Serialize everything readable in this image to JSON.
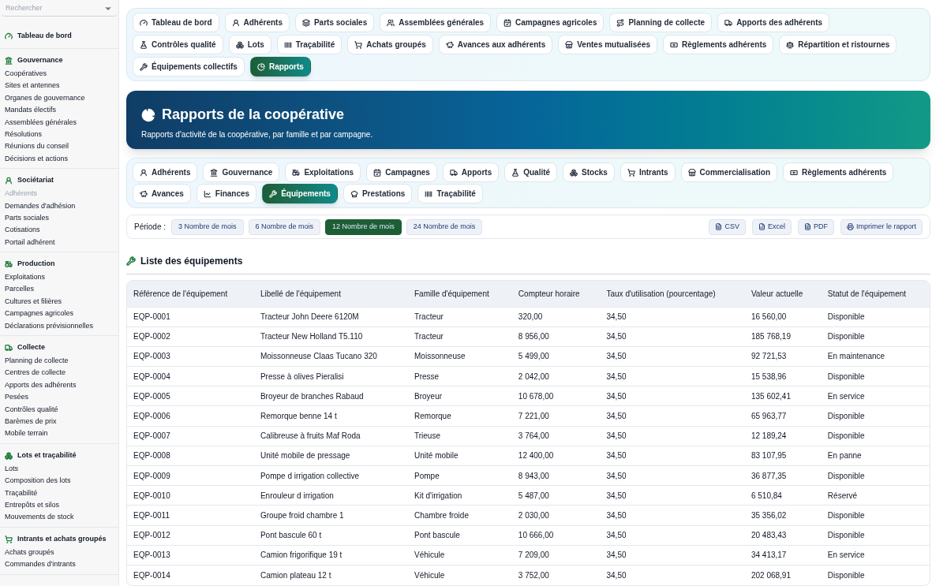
{
  "sidebar": {
    "search": {
      "placeholder": "Rechercher"
    },
    "sections": [
      {
        "title": "Tableau de bord"
      },
      {
        "title": "Gouvernance",
        "items": [
          {
            "label": "Coopératives",
            "disabled": false
          },
          {
            "label": "Sites et antennes",
            "disabled": false
          },
          {
            "label": "Organes de gouvernance",
            "disabled": false
          },
          {
            "label": "Mandats électifs",
            "disabled": false
          },
          {
            "label": "Assemblées générales",
            "disabled": false
          },
          {
            "label": "Résolutions",
            "disabled": false
          },
          {
            "label": "Réunions du conseil",
            "disabled": false
          },
          {
            "label": "Décisions et actions",
            "disabled": false
          }
        ]
      },
      {
        "title": "Sociétariat",
        "items": [
          {
            "label": "Adhérents",
            "disabled": true
          },
          {
            "label": "Demandes d'adhésion",
            "disabled": false
          },
          {
            "label": "Parts sociales",
            "disabled": false
          },
          {
            "label": "Cotisations",
            "disabled": false
          },
          {
            "label": "Portail adhérent",
            "disabled": false
          }
        ]
      },
      {
        "title": "Production",
        "items": [
          {
            "label": "Exploitations",
            "disabled": false
          },
          {
            "label": "Parcelles",
            "disabled": false
          },
          {
            "label": "Cultures et filières",
            "disabled": false
          },
          {
            "label": "Campagnes agricoles",
            "disabled": false
          },
          {
            "label": "Déclarations prévisionnelles",
            "disabled": false
          }
        ]
      },
      {
        "title": "Collecte",
        "items": [
          {
            "label": "Planning de collecte",
            "disabled": false
          },
          {
            "label": "Centres de collecte",
            "disabled": false
          },
          {
            "label": "Apports des adhérents",
            "disabled": false
          },
          {
            "label": "Pesées",
            "disabled": false
          },
          {
            "label": "Contrôles qualité",
            "disabled": false
          },
          {
            "label": "Barèmes de prix",
            "disabled": false
          },
          {
            "label": "Mobile terrain",
            "disabled": false
          }
        ]
      },
      {
        "title": "Lots et traçabilité",
        "items": [
          {
            "label": "Lots",
            "disabled": false
          },
          {
            "label": "Composition des lots",
            "disabled": false
          },
          {
            "label": "Traçabilité",
            "disabled": false
          },
          {
            "label": "Entrepôts et silos",
            "disabled": false
          },
          {
            "label": "Mouvements de stock",
            "disabled": false
          }
        ]
      },
      {
        "title": "Intrants et achats groupés",
        "items": [
          {
            "label": "Achats groupés",
            "disabled": false
          },
          {
            "label": "Commandes d'intrants",
            "disabled": false
          }
        ]
      }
    ]
  },
  "top_nav": [
    {
      "label": "Tableau de bord",
      "selected": false
    },
    {
      "label": "Adhérents",
      "selected": false
    },
    {
      "label": "Parts sociales",
      "selected": false
    },
    {
      "label": "Assemblées générales",
      "selected": false
    },
    {
      "label": "Campagnes agricoles",
      "selected": false
    },
    {
      "label": "Planning de collecte",
      "selected": false
    },
    {
      "label": "Apports des adhérents",
      "selected": false
    },
    {
      "label": "Contrôles qualité",
      "selected": false
    },
    {
      "label": "Lots",
      "selected": false
    },
    {
      "label": "Traçabilité",
      "selected": false
    },
    {
      "label": "Achats groupés",
      "selected": false
    },
    {
      "label": "Avances aux adhérents",
      "selected": false
    },
    {
      "label": "Ventes mutualisées",
      "selected": false
    },
    {
      "label": "Règlements adhérents",
      "selected": false
    },
    {
      "label": "Répartition et ristournes",
      "selected": false
    },
    {
      "label": "Équipements collectifs",
      "selected": false
    },
    {
      "label": "Rapports",
      "selected": true
    }
  ],
  "header": {
    "title": "Rapports de la coopérative",
    "subtitle": "Rapports d'activité de la coopérative, par famille et par campagne."
  },
  "report_tabs": [
    {
      "label": "Adhérents",
      "selected": false
    },
    {
      "label": "Gouvernance",
      "selected": false
    },
    {
      "label": "Exploitations",
      "selected": false
    },
    {
      "label": "Campagnes",
      "selected": false
    },
    {
      "label": "Apports",
      "selected": false
    },
    {
      "label": "Qualité",
      "selected": false
    },
    {
      "label": "Stocks",
      "selected": false
    },
    {
      "label": "Intrants",
      "selected": false
    },
    {
      "label": "Commercialisation",
      "selected": false
    },
    {
      "label": "Règlements adhérents",
      "selected": false
    },
    {
      "label": "Avances",
      "selected": false
    },
    {
      "label": "Finances",
      "selected": false
    },
    {
      "label": "Équipements",
      "selected": true
    },
    {
      "label": "Prestations",
      "selected": false
    },
    {
      "label": "Traçabilité",
      "selected": false
    }
  ],
  "period": {
    "label": "Période :",
    "options": [
      {
        "label": "3 Nombre de mois",
        "selected": false
      },
      {
        "label": "6 Nombre de mois",
        "selected": false
      },
      {
        "label": "12 Nombre de mois",
        "selected": true
      },
      {
        "label": "24 Nombre de mois",
        "selected": false
      }
    ]
  },
  "exports": [
    "CSV",
    "Excel",
    "PDF",
    "Imprimer le rapport"
  ],
  "section_title": "Liste des équipements",
  "table": {
    "columns": [
      "Référence de l'équipement",
      "Libellé de l'équipement",
      "Famille d'équipement",
      "Compteur horaire",
      "Taux d'utilisation (pourcentage)",
      "Valeur actuelle",
      "Statut de l'équipement"
    ],
    "rows": [
      [
        "EQP-0001",
        "Tracteur John Deere 6120M",
        "Tracteur",
        "320,00",
        "34,50",
        "16 560,00",
        "Disponible"
      ],
      [
        "EQP-0002",
        "Tracteur New Holland T5.110",
        "Tracteur",
        "8 956,00",
        "34,50",
        "185 768,19",
        "Disponible"
      ],
      [
        "EQP-0003",
        "Moissonneuse Claas Tucano 320",
        "Moissonneuse",
        "5 499,00",
        "34,50",
        "92 721,53",
        "En maintenance"
      ],
      [
        "EQP-0004",
        "Presse à olives Pieralisi",
        "Presse",
        "2 042,00",
        "34,50",
        "15 538,96",
        "Disponible"
      ],
      [
        "EQP-0005",
        "Broyeur de branches Rabaud",
        "Broyeur",
        "10 678,00",
        "34,50",
        "135 602,41",
        "En service"
      ],
      [
        "EQP-0006",
        "Remorque benne 14 t",
        "Remorque",
        "7 221,00",
        "34,50",
        "65 963,77",
        "Disponible"
      ],
      [
        "EQP-0007",
        "Calibreuse à fruits Maf Roda",
        "Trieuse",
        "3 764,00",
        "34,50",
        "12 189,24",
        "Disponible"
      ],
      [
        "EQP-0008",
        "Unité mobile de pressage",
        "Unité mobile",
        "12 400,00",
        "34,50",
        "83 107,95",
        "En panne"
      ],
      [
        "EQP-0009",
        "Pompe d irrigation collective",
        "Pompe",
        "8 943,00",
        "34,50",
        "36 877,35",
        "Disponible"
      ],
      [
        "EQP-0010",
        "Enrouleur d irrigation",
        "Kit d'irrigation",
        "5 487,00",
        "34,50",
        "6 510,84",
        "Réservé"
      ],
      [
        "EQP-0011",
        "Groupe froid chambre 1",
        "Chambre froide",
        "2 030,00",
        "34,50",
        "35 356,02",
        "Disponible"
      ],
      [
        "EQP-0012",
        "Pont bascule 60 t",
        "Pont bascule",
        "10 666,00",
        "34,50",
        "20 483,43",
        "Disponible"
      ],
      [
        "EQP-0013",
        "Camion frigorifique 19 t",
        "Véhicule",
        "7 209,00",
        "34,50",
        "34 413,17",
        "En service"
      ],
      [
        "EQP-0014",
        "Camion plateau 12 t",
        "Véhicule",
        "3 752,00",
        "34,50",
        "202 068,91",
        "Disponible"
      ]
    ]
  }
}
